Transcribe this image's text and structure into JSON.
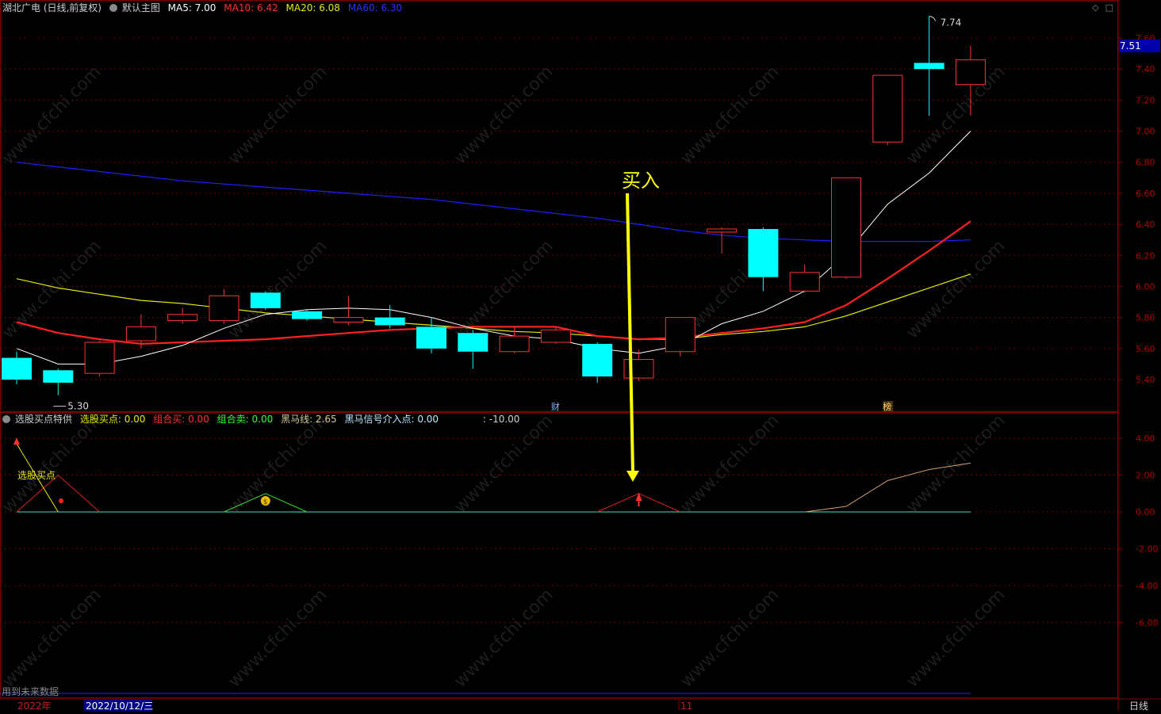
{
  "main_header": {
    "stock": "湖北广电 (日线,前复权)",
    "template": "默认主图",
    "ma5": "MA5: 7.00",
    "ma10": "MA10: 6.42",
    "ma20": "MA20: 6.08",
    "ma60": "MA60: 6.30"
  },
  "sub_header": {
    "indicator": "选股买点特供",
    "buy_point": "选股买点: 0.00",
    "combo_buy": "组合买: 0.00",
    "combo_sell": "组合卖: 0.00",
    "dark_horse": "黑马线: 2.65",
    "dark_horse_entry": "黑马信号介入点: 0.00",
    "extra": ": -10.00"
  },
  "annotations": {
    "buy_label": "买入",
    "high_label": "7.74",
    "low_label": "5.30",
    "sub_label": "选股买点",
    "news_marker_1": "财",
    "news_marker_2": "榜",
    "current_price": "7.51",
    "footer_note": "用到未来数据",
    "year": "2022年",
    "date": "2022/10/12/三",
    "month_tick": "11",
    "period": "日线"
  },
  "colors": {
    "up": "#ff3232",
    "down": "#00ffff",
    "ma5": "#ffffff",
    "ma10": "#ff2020",
    "ma20": "#e8e800",
    "ma60": "#1f1fff",
    "axis": "#800000",
    "buy_arrow": "#ffff00"
  },
  "chart_data": [
    {
      "type": "candlestick",
      "title": "湖北广电 (日线,前复权)",
      "ylim": [
        5.2,
        7.7
      ],
      "yticks": [
        5.4,
        5.6,
        5.8,
        6.0,
        6.2,
        6.4,
        6.6,
        6.8,
        7.0,
        7.2,
        7.4,
        7.6
      ],
      "candles": [
        {
          "o": 5.54,
          "c": 5.4,
          "h": 5.58,
          "l": 5.37
        },
        {
          "o": 5.46,
          "c": 5.38,
          "h": 5.47,
          "l": 5.3
        },
        {
          "o": 5.44,
          "c": 5.64,
          "h": 5.65,
          "l": 5.42
        },
        {
          "o": 5.65,
          "c": 5.74,
          "h": 5.82,
          "l": 5.6
        },
        {
          "o": 5.78,
          "c": 5.82,
          "h": 5.86,
          "l": 5.76
        },
        {
          "o": 5.78,
          "c": 5.94,
          "h": 5.98,
          "l": 5.76
        },
        {
          "o": 5.96,
          "c": 5.86,
          "h": 5.97,
          "l": 5.85
        },
        {
          "o": 5.84,
          "c": 5.79,
          "h": 5.85,
          "l": 5.78
        },
        {
          "o": 5.77,
          "c": 5.8,
          "h": 5.94,
          "l": 5.75
        },
        {
          "o": 5.8,
          "c": 5.75,
          "h": 5.88,
          "l": 5.73
        },
        {
          "o": 5.74,
          "c": 5.6,
          "h": 5.8,
          "l": 5.57
        },
        {
          "o": 5.7,
          "c": 5.58,
          "h": 5.72,
          "l": 5.47
        },
        {
          "o": 5.58,
          "c": 5.68,
          "h": 5.74,
          "l": 5.57
        },
        {
          "o": 5.64,
          "c": 5.72,
          "h": 5.74,
          "l": 5.63
        },
        {
          "o": 5.63,
          "c": 5.42,
          "h": 5.64,
          "l": 5.38
        },
        {
          "o": 5.41,
          "c": 5.53,
          "h": 5.59,
          "l": 5.39
        },
        {
          "o": 5.58,
          "c": 5.8,
          "h": 5.8,
          "l": 5.55
        },
        {
          "o": 6.35,
          "c": 6.37,
          "h": 6.38,
          "l": 6.21
        },
        {
          "o": 6.37,
          "c": 6.06,
          "h": 6.38,
          "l": 5.97
        },
        {
          "o": 5.97,
          "c": 6.09,
          "h": 6.14,
          "l": 5.96
        },
        {
          "o": 6.06,
          "c": 6.7,
          "h": 6.7,
          "l": 6.05
        },
        {
          "o": 6.93,
          "c": 7.36,
          "h": 7.36,
          "l": 6.91
        },
        {
          "o": 7.44,
          "c": 7.4,
          "h": 7.74,
          "l": 7.1
        },
        {
          "o": 7.3,
          "c": 7.46,
          "h": 7.55,
          "l": 7.1
        }
      ],
      "ma5": [
        5.6,
        5.5,
        5.5,
        5.55,
        5.62,
        5.73,
        5.82,
        5.85,
        5.86,
        5.85,
        5.8,
        5.73,
        5.68,
        5.66,
        5.6,
        5.57,
        5.62,
        5.76,
        5.84,
        5.97,
        6.21,
        6.53,
        6.73,
        7.0
      ],
      "ma10": [
        5.77,
        5.7,
        5.66,
        5.63,
        5.64,
        5.65,
        5.66,
        5.68,
        5.7,
        5.72,
        5.73,
        5.74,
        5.74,
        5.74,
        5.68,
        5.66,
        5.67,
        5.7,
        5.73,
        5.77,
        5.88,
        6.05,
        6.23,
        6.42
      ],
      "ma20": [
        6.05,
        5.99,
        5.95,
        5.91,
        5.89,
        5.86,
        5.83,
        5.81,
        5.79,
        5.77,
        5.75,
        5.73,
        5.71,
        5.7,
        5.68,
        5.66,
        5.66,
        5.69,
        5.71,
        5.74,
        5.81,
        5.9,
        5.99,
        6.08
      ],
      "ma60": [
        6.8,
        6.77,
        6.74,
        6.71,
        6.68,
        6.66,
        6.64,
        6.62,
        6.6,
        6.58,
        6.56,
        6.53,
        6.5,
        6.47,
        6.44,
        6.4,
        6.36,
        6.33,
        6.31,
        6.3,
        6.29,
        6.29,
        6.29,
        6.3
      ]
    },
    {
      "type": "line",
      "title": "选股买点特供",
      "ylim": [
        -10,
        5
      ],
      "yticks": [
        4.0,
        2.0,
        0.0,
        -2.0,
        -4.0,
        -6.0
      ],
      "series": [
        {
          "name": "黑马线",
          "values": [
            0,
            0,
            0,
            0,
            0,
            0,
            0,
            0,
            0,
            0,
            0,
            0,
            0,
            0,
            0,
            0,
            0,
            0,
            0,
            0,
            0.3,
            1.7,
            2.3,
            2.65
          ]
        }
      ],
      "triangles": [
        {
          "index": 1,
          "peak": 2.0,
          "color": "red"
        },
        {
          "index": 6,
          "peak": 1.0,
          "color": "green"
        },
        {
          "index": 15,
          "peak": 1.0,
          "color": "red"
        }
      ]
    }
  ]
}
